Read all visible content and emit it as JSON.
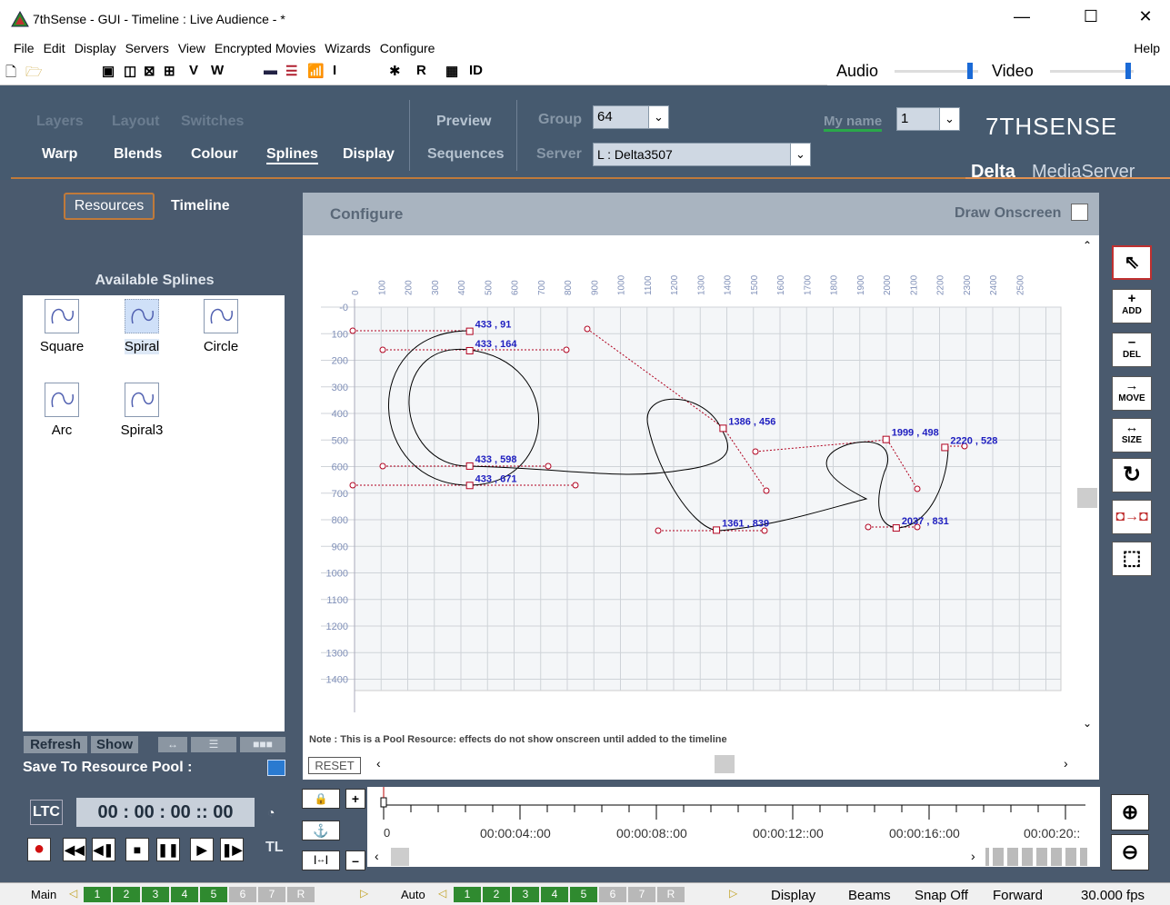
{
  "window": {
    "title": "7thSense -   GUI  - Timeline : Live Audience  - *",
    "minimize": "—",
    "maximize": "☐",
    "close": "✕"
  },
  "menu": {
    "items": [
      "File",
      "Edit",
      "Display",
      "Servers",
      "View",
      "Encrypted Movies",
      "Wizards",
      "Configure"
    ],
    "help": "Help"
  },
  "toolbar": {
    "labels": [
      "V",
      "W",
      "I",
      "R",
      "ID"
    ],
    "audio_label": "Audio",
    "video_label": "Video"
  },
  "nav": {
    "row1": [
      "Layers",
      "Layout",
      "Switches"
    ],
    "row2": [
      "Warp",
      "Blends",
      "Colour",
      "Splines",
      "Display"
    ],
    "preview": "Preview",
    "sequences": "Sequences",
    "group_label": "Group",
    "group_value": "64",
    "server_label": "Server",
    "server_value": "L : Delta3507",
    "myname_label": "My name",
    "myname_value": "1",
    "brand": "7THSENSE",
    "product_bold": "Delta",
    "product_rest": "MediaServer"
  },
  "left": {
    "tabs": [
      "Resources",
      "Timeline"
    ],
    "heading": "Available Splines",
    "splines": [
      "Square",
      "Spiral",
      "Circle",
      "Arc",
      "Spiral3"
    ],
    "refresh": "Refresh",
    "show": "Show",
    "save_label": "Save To Resource Pool :"
  },
  "config": {
    "title": "Configure",
    "draw_onscreen": "Draw Onscreen",
    "note": "Note : This is a Pool Resource: effects do not show onscreen until added to the timeline",
    "reset": "RESET",
    "x_ticks": [
      "0",
      "100",
      "200",
      "300",
      "400",
      "500",
      "600",
      "700",
      "800",
      "900",
      "1000",
      "1100",
      "1200",
      "1300",
      "1400",
      "1500",
      "1600",
      "1700",
      "1800",
      "1900",
      "2000",
      "2100",
      "2200",
      "2300",
      "2400",
      "2500"
    ],
    "y_ticks": [
      "0",
      "100",
      "200",
      "300",
      "400",
      "500",
      "600",
      "700",
      "800",
      "900",
      "1000",
      "1100",
      "1200",
      "1300",
      "1400"
    ],
    "point_labels": [
      "433 , 91",
      "433 , 164",
      "433 , 598",
      "433 , 671",
      "1386 , 456",
      "1361 , 839",
      "1999 , 498",
      "2220 , 528",
      "2037 , 831"
    ]
  },
  "right_tools": [
    "ADD",
    "DEL",
    "MOVE",
    "SIZE"
  ],
  "transport": {
    "ltc": "LTC",
    "timecode": "00 : 00 : 00 :: 00",
    "tl": "TL"
  },
  "timeline": {
    "zero": "0",
    "marks": [
      "00:00:04::00",
      "00:00:08::00",
      "00:00:12::00",
      "00:00:16::00",
      "00:00:20::"
    ]
  },
  "status": {
    "main": "Main",
    "auto": "Auto",
    "groups": [
      "1",
      "2",
      "3",
      "4",
      "5",
      "6",
      "7",
      "R"
    ],
    "display": "Display",
    "beams": "Beams",
    "snap": "Snap Off",
    "forward": "Forward",
    "fps": "30.000 fps"
  },
  "colors": {
    "accent": "#c07a3a",
    "panel": "#4a5a6e",
    "status_green": "#2f8a2f",
    "point_red": "#b0001e",
    "label_blue": "#2020c0"
  }
}
